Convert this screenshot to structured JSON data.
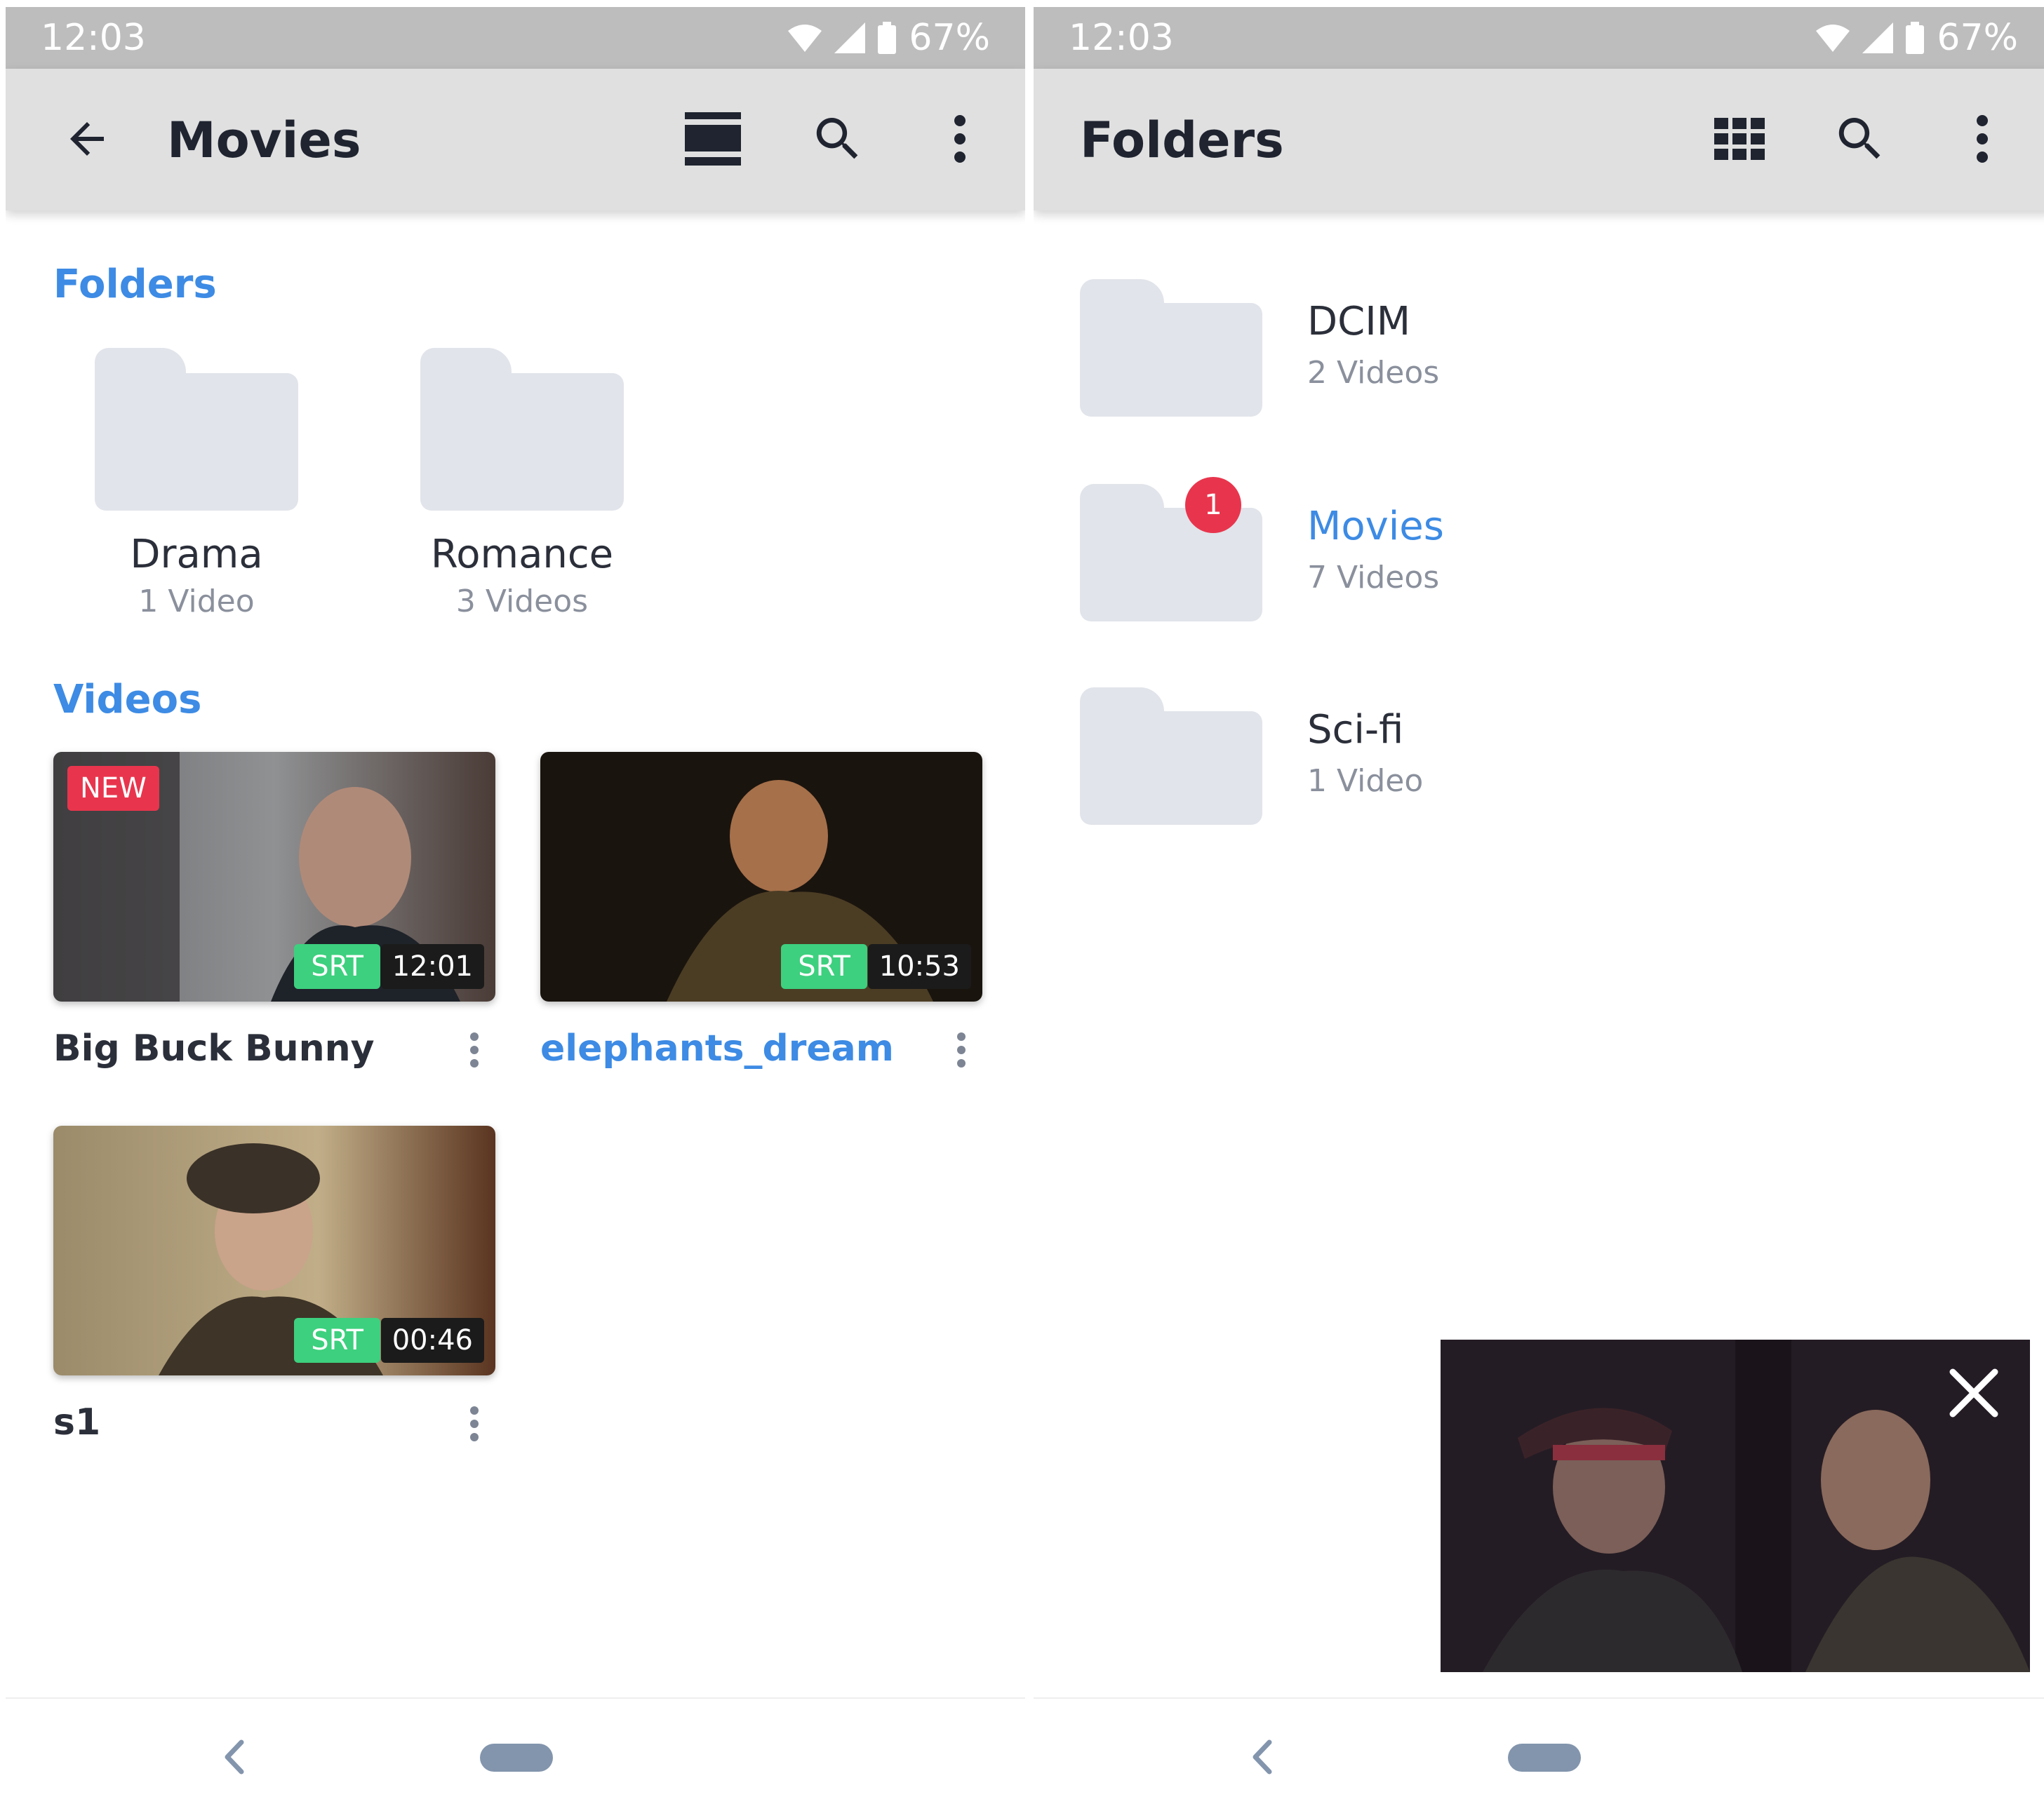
{
  "left": {
    "status": {
      "time": "12:03",
      "battery": "67%"
    },
    "appbar": {
      "title": "Movies",
      "back_icon": "arrow-back-icon",
      "view_icon": "list-view-icon",
      "search_icon": "search-icon",
      "menu_icon": "more-vert-icon"
    },
    "folders_heading": "Folders",
    "folders": [
      {
        "name": "Drama",
        "count": "1 Video"
      },
      {
        "name": "Romance",
        "count": "3 Videos"
      }
    ],
    "videos_heading": "Videos",
    "videos": [
      {
        "title": "Big Buck Bunny",
        "duration": "12:01",
        "subtitle_badge": "SRT",
        "new_badge": "NEW",
        "active": false
      },
      {
        "title": "elephants_dream",
        "duration": "10:53",
        "subtitle_badge": "SRT",
        "active": true
      },
      {
        "title": "s1",
        "duration": "00:46",
        "subtitle_badge": "SRT",
        "active": false
      }
    ]
  },
  "right": {
    "status": {
      "time": "12:03",
      "battery": "67%"
    },
    "appbar": {
      "title": "Folders",
      "view_icon": "grid-view-icon",
      "search_icon": "search-icon",
      "menu_icon": "more-vert-icon"
    },
    "folders": [
      {
        "name": "DCIM",
        "count": "2 Videos",
        "active": false
      },
      {
        "name": "Movies",
        "count": "7 Videos",
        "active": true,
        "badge": "1"
      },
      {
        "name": "Sci-fi",
        "count": "1 Video",
        "active": false
      }
    ],
    "pip": {
      "close_icon": "close-icon"
    }
  },
  "colors": {
    "accent": "#3d8be4",
    "new_badge": "#e8354d",
    "srt_badge": "#3dd07e",
    "status_bar": "#bdbdbd",
    "app_bar": "#e0e0e0",
    "folder": "#e1e4ea",
    "nav_home": "#8395ad"
  }
}
